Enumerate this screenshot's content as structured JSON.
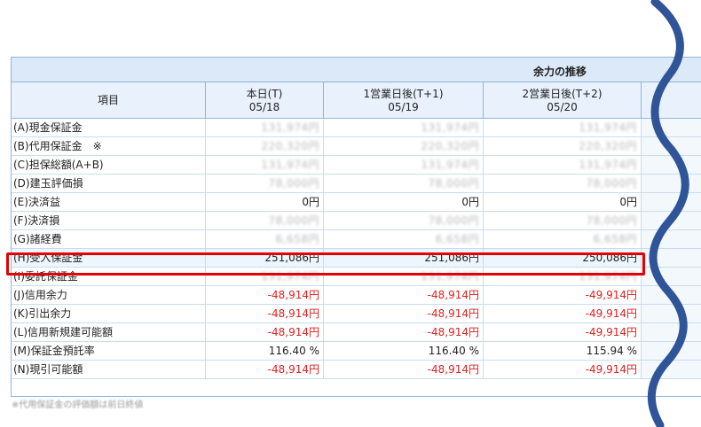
{
  "table": {
    "title": "余力の推移",
    "headers": {
      "item": "項目",
      "today": {
        "line1": "本日(T)",
        "line2": "05/18"
      },
      "t1": {
        "line1": "1営業日後(T+1)",
        "line2": "05/19"
      },
      "t2": {
        "line1": "2営業日後(T+2)",
        "line2": "05/20"
      }
    },
    "rows": [
      {
        "label": "(A)現金保証金",
        "values": [
          "131,974円",
          "131,974円",
          "131,974円"
        ],
        "style": "blur"
      },
      {
        "label": "(B)代用保証金　※",
        "values": [
          "220,320円",
          "220,320円",
          "220,320円"
        ],
        "style": "blur"
      },
      {
        "label": "(C)担保総額(A+B)",
        "values": [
          "131,974円",
          "131,974円",
          "131,974円"
        ],
        "style": "blur"
      },
      {
        "label": "(D)建玉評価損",
        "values": [
          "78,000円",
          "78,000円",
          "78,000円"
        ],
        "style": "blur"
      },
      {
        "label": "(E)決済益",
        "values": [
          "0円",
          "0円",
          "0円"
        ],
        "style": "normal"
      },
      {
        "label": "(F)決済損",
        "values": [
          "78,000円",
          "78,000円",
          "78,000円"
        ],
        "style": "blur"
      },
      {
        "label": "(G)諸経費",
        "values": [
          "6,658円",
          "6,658円",
          "6,658円"
        ],
        "style": "blur"
      },
      {
        "label": "(H)受入保証金",
        "values": [
          "251,086円",
          "251,086円",
          "250,086円"
        ],
        "style": "highlight"
      },
      {
        "label": "(I)委託保証金",
        "values": [
          "131,974円",
          "131,974円",
          "131,974円"
        ],
        "style": "blur"
      },
      {
        "label": "(J)信用余力",
        "values": [
          "-48,914円",
          "-48,914円",
          "-49,914円"
        ],
        "style": "negative"
      },
      {
        "label": "(K)引出余力",
        "values": [
          "-48,914円",
          "-48,914円",
          "-49,914円"
        ],
        "style": "negative"
      },
      {
        "label": "(L)信用新規建可能額",
        "values": [
          "-48,914円",
          "-48,914円",
          "-49,914円"
        ],
        "style": "negative"
      },
      {
        "label": "(M)保証金預託率",
        "values": [
          "116.40 %",
          "116.40 %",
          "115.94 %"
        ],
        "style": "normal"
      },
      {
        "label": "(N)現引可能額",
        "values": [
          "-48,914円",
          "-48,914円",
          "-49,914円"
        ],
        "style": "negative"
      }
    ],
    "footnote": "※代用保証金の評価額は前日終値"
  },
  "colors": {
    "header_bg": "#dbe9f8",
    "border": "#8fb4d9",
    "negative": "#e02020",
    "highlight": "#e30000",
    "wave": "#2f5497"
  }
}
